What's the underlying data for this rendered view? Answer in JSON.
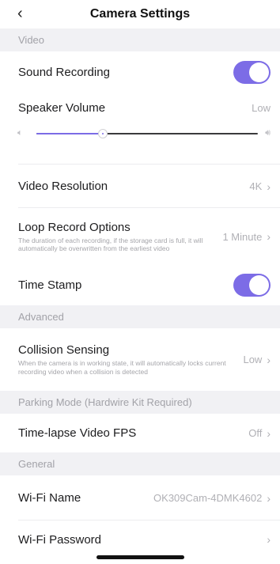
{
  "header": {
    "back_icon": "chevron-left-icon",
    "title": "Camera Settings"
  },
  "sections": {
    "video": "Video",
    "advanced": "Advanced",
    "parking": "Parking Mode (Hardwire Kit Required)",
    "general": "General"
  },
  "sound_recording": {
    "label": "Sound Recording",
    "enabled": true
  },
  "speaker_volume": {
    "label": "Speaker Volume",
    "value": "Low",
    "level": 0.3
  },
  "video_resolution": {
    "label": "Video Resolution",
    "value": "4K"
  },
  "loop_record": {
    "label": "Loop Record Options",
    "description": "The duration of each recording, if the storage card is full, it will automatically be overwritten from the earliest video",
    "value": "1 Minute"
  },
  "time_stamp": {
    "label": "Time Stamp",
    "enabled": true
  },
  "collision_sensing": {
    "label": "Collision Sensing",
    "description": "When the camera is in working state, it will automatically locks current recording video when a collision is detected",
    "value": "Low"
  },
  "timelapse": {
    "label": "Time-lapse Video FPS",
    "value": "Off"
  },
  "wifi_name": {
    "label": "Wi-Fi Name",
    "value": "OK309Cam-4DMK4602"
  },
  "wifi_password": {
    "label": "Wi-Fi Password",
    "value": ""
  },
  "colors": {
    "accent": "#7c6ce6",
    "section_bg": "#f1f1f4"
  },
  "icons": {
    "chevron": "chevron-right-icon",
    "volume_low": "speaker-low-icon",
    "volume_high": "speaker-high-icon"
  }
}
